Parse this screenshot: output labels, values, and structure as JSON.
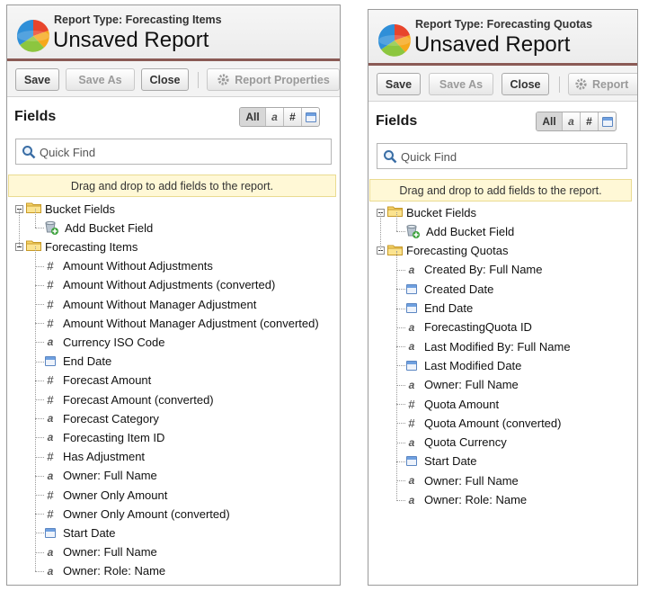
{
  "left": {
    "report_type": "Report Type: Forecasting Items",
    "title": "Unsaved Report",
    "toolbar": {
      "save": "Save",
      "save_as": "Save As",
      "close": "Close",
      "properties": "Report Properties"
    },
    "fields_title": "Fields",
    "filter_all": "All",
    "filter_num": "#",
    "search_placeholder": "Quick Find",
    "hint": "Drag and drop to add fields to the report.",
    "bucket_folder": "Bucket Fields",
    "add_bucket": "Add Bucket Field",
    "items_folder": "Forecasting Items",
    "fields": [
      {
        "icon": "number-icon",
        "label": "Amount Without Adjustments"
      },
      {
        "icon": "number-icon",
        "label": "Amount Without Adjustments (converted)"
      },
      {
        "icon": "number-icon",
        "label": "Amount Without Manager Adjustment"
      },
      {
        "icon": "number-icon",
        "label": "Amount Without Manager Adjustment (converted)"
      },
      {
        "icon": "text-icon",
        "label": "Currency ISO Code"
      },
      {
        "icon": "date-icon",
        "label": "End Date"
      },
      {
        "icon": "number-icon",
        "label": "Forecast Amount"
      },
      {
        "icon": "number-icon",
        "label": "Forecast Amount (converted)"
      },
      {
        "icon": "text-icon",
        "label": "Forecast Category"
      },
      {
        "icon": "text-icon",
        "label": "Forecasting Item ID"
      },
      {
        "icon": "number-icon",
        "label": "Has Adjustment"
      },
      {
        "icon": "text-icon",
        "label": "Owner: Full Name"
      },
      {
        "icon": "number-icon",
        "label": "Owner Only Amount"
      },
      {
        "icon": "number-icon",
        "label": "Owner Only Amount (converted)"
      },
      {
        "icon": "date-icon",
        "label": "Start Date"
      },
      {
        "icon": "text-icon",
        "label": "Owner: Full Name"
      },
      {
        "icon": "text-icon",
        "label": "Owner: Role: Name"
      }
    ]
  },
  "right": {
    "report_type": "Report Type: Forecasting Quotas",
    "title": "Unsaved Report",
    "toolbar": {
      "save": "Save",
      "save_as": "Save As",
      "close": "Close",
      "properties": "Report"
    },
    "fields_title": "Fields",
    "filter_all": "All",
    "filter_num": "#",
    "search_placeholder": "Quick Find",
    "hint": "Drag and drop to add fields to the report.",
    "bucket_folder": "Bucket Fields",
    "add_bucket": "Add Bucket Field",
    "items_folder": "Forecasting Quotas",
    "fields": [
      {
        "icon": "text-icon",
        "label": "Created By: Full Name"
      },
      {
        "icon": "date-icon",
        "label": "Created Date"
      },
      {
        "icon": "date-icon",
        "label": "End Date"
      },
      {
        "icon": "text-icon",
        "label": "ForecastingQuota ID"
      },
      {
        "icon": "text-icon",
        "label": "Last Modified By: Full Name"
      },
      {
        "icon": "date-icon",
        "label": "Last Modified Date"
      },
      {
        "icon": "text-icon",
        "label": "Owner: Full Name"
      },
      {
        "icon": "number-icon",
        "label": "Quota Amount"
      },
      {
        "icon": "number-icon",
        "label": "Quota Amount (converted)"
      },
      {
        "icon": "text-icon",
        "label": "Quota Currency"
      },
      {
        "icon": "date-icon",
        "label": "Start Date"
      },
      {
        "icon": "text-icon",
        "label": "Owner: Full Name"
      },
      {
        "icon": "text-icon",
        "label": "Owner: Role: Name"
      }
    ]
  },
  "colors": {
    "header_rule": "#8a5a55",
    "hint_bg": "#fff8d6",
    "date_icon": "#5b86c2"
  }
}
